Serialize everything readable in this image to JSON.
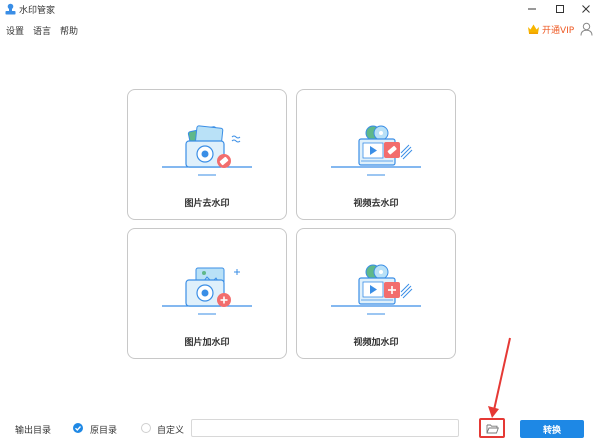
{
  "window": {
    "title": "水印管家"
  },
  "menu": {
    "items": [
      "设置",
      "语言",
      "帮助"
    ]
  },
  "vip": {
    "label": "开通VIP"
  },
  "cards": [
    {
      "label": "图片去水印"
    },
    {
      "label": "视频去水印"
    },
    {
      "label": "图片加水印"
    },
    {
      "label": "视频加水印"
    }
  ],
  "bottom": {
    "output_label": "输出目录",
    "options": [
      {
        "label": "原目录",
        "selected": true
      },
      {
        "label": "自定义",
        "selected": false
      }
    ],
    "path_value": "",
    "convert_label": "转换"
  },
  "colors": {
    "accent": "#1e88e5",
    "vip": "#ee5a24",
    "highlight": "#e53935"
  },
  "icons": {
    "logo": "stamp-logo-icon",
    "folder": "folder-open-icon",
    "user": "user-icon",
    "vip": "crown-icon"
  }
}
